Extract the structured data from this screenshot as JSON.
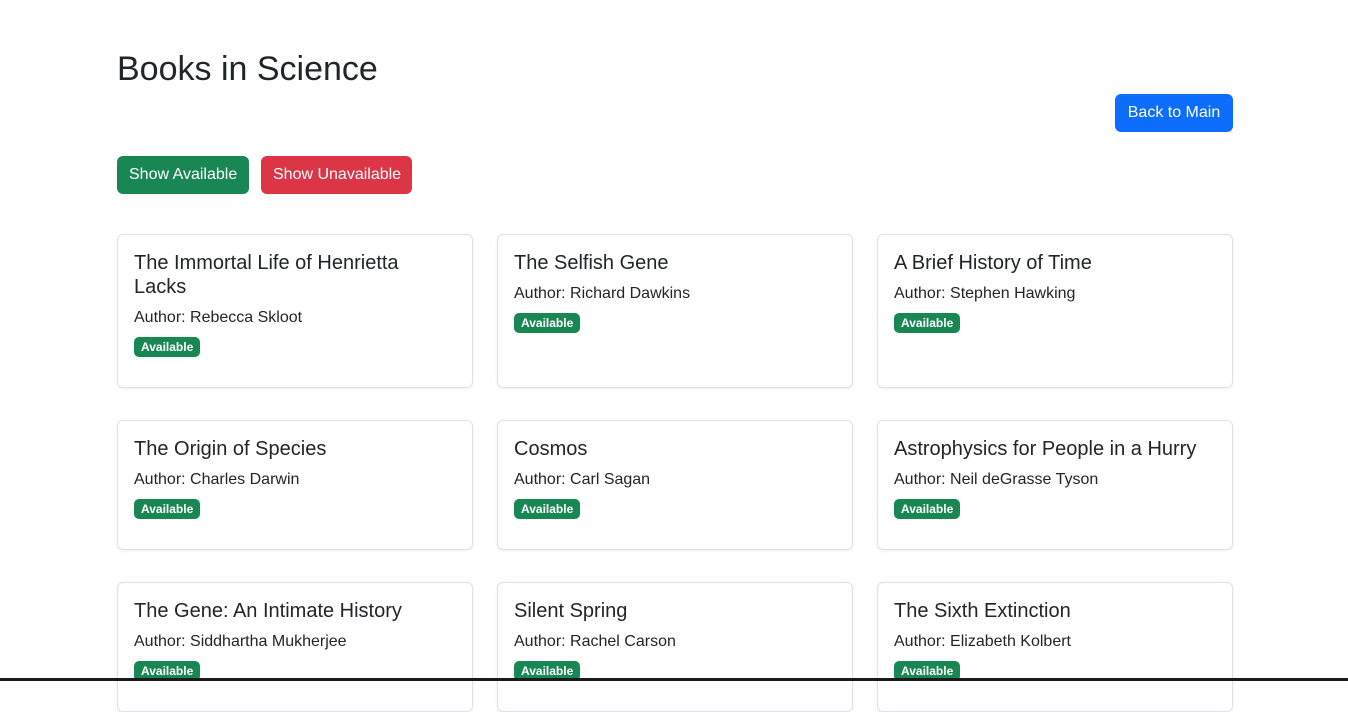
{
  "page": {
    "title": "Books in Science"
  },
  "buttons": {
    "back": "Back to Main",
    "show_available": "Show Available",
    "show_unavailable": "Show Unavailable"
  },
  "colors": {
    "primary": "#0d6efd",
    "success": "#198754",
    "danger": "#dc3545"
  },
  "books": [
    {
      "title": "The Immortal Life of Henrietta Lacks",
      "author": "Author: Rebecca Skloot",
      "status": "Available"
    },
    {
      "title": "The Selfish Gene",
      "author": "Author: Richard Dawkins",
      "status": "Available"
    },
    {
      "title": "A Brief History of Time",
      "author": "Author: Stephen Hawking",
      "status": "Available"
    },
    {
      "title": "The Origin of Species",
      "author": "Author: Charles Darwin",
      "status": "Available"
    },
    {
      "title": "Cosmos",
      "author": "Author: Carl Sagan",
      "status": "Available"
    },
    {
      "title": "Astrophysics for People in a Hurry",
      "author": "Author: Neil deGrasse Tyson",
      "status": "Available"
    },
    {
      "title": "The Gene: An Intimate History",
      "author": "Author: Siddhartha Mukherjee",
      "status": "Available"
    },
    {
      "title": "Silent Spring",
      "author": "Author: Rachel Carson",
      "status": "Available"
    },
    {
      "title": "The Sixth Extinction",
      "author": "Author: Elizabeth Kolbert",
      "status": "Available"
    }
  ]
}
